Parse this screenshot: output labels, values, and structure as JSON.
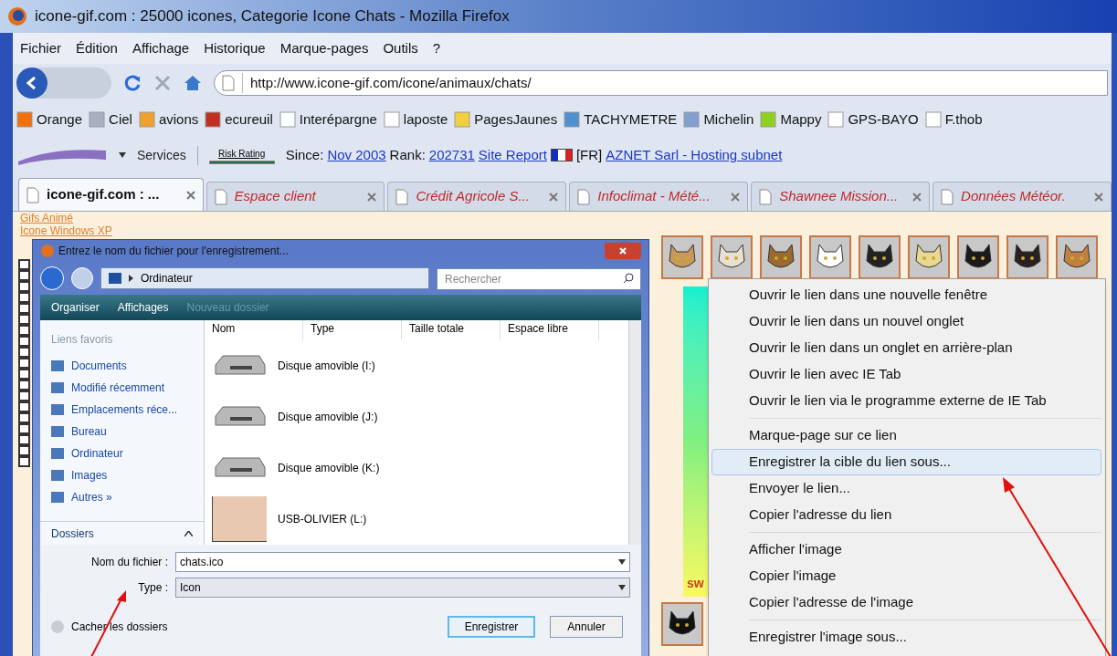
{
  "window": {
    "title": "icone-gif.com : 25000 icones, Categorie Icone Chats - Mozilla Firefox"
  },
  "menu_bar": [
    "Fichier",
    "Édition",
    "Affichage",
    "Historique",
    "Marque-pages",
    "Outils",
    "?"
  ],
  "address_bar": {
    "value": "http://www.icone-gif.com/icone/animaux/chats/"
  },
  "bookmarks": [
    "Orange",
    "Ciel",
    "avions",
    "ecureuil",
    "Interépargne",
    "laposte",
    "PagesJaunes",
    "TACHYMETRE",
    "Michelin",
    "Mappy",
    "GPS-BAYO",
    "F.thob"
  ],
  "netcraft_bar": {
    "services": "Services",
    "risk_label": "Risk Rating",
    "since_label": "Since:",
    "since": "Nov 2003",
    "rank_label": "Rank:",
    "rank": "202731",
    "report": "Site Report",
    "country": "[FR]",
    "host": "AZNET Sarl - Hosting subnet"
  },
  "tabs": [
    {
      "label": "icone-gif.com : ...",
      "selected": true
    },
    {
      "label": "Espace client",
      "selected": false
    },
    {
      "label": "Crédit Agricole S...",
      "selected": false
    },
    {
      "label": "Infoclimat - Mété...",
      "selected": false
    },
    {
      "label": "Shawnee Mission...",
      "selected": false
    },
    {
      "label": "Données Météor.",
      "selected": false
    }
  ],
  "page": {
    "links": [
      "Gifs Animé",
      "Icone Windows XP"
    ],
    "banner_text": "sw"
  },
  "save_dialog": {
    "title": "Entrez le nom du fichier pour l'enregistrement...",
    "path": "Ordinateur",
    "search_placeholder": "Rechercher",
    "toolbar": [
      {
        "label": "Organiser",
        "disabled": false
      },
      {
        "label": "Affichages",
        "disabled": false
      },
      {
        "label": "Nouveau dossier",
        "disabled": true
      }
    ],
    "favorites_title": "Liens favoris",
    "favorites": [
      "Documents",
      "Modifié récemment",
      "Emplacements réce...",
      "Bureau",
      "Ordinateur",
      "Images",
      "Autres »"
    ],
    "folders_label": "Dossiers",
    "columns": [
      "Nom",
      "Type",
      "Taille totale",
      "Espace libre"
    ],
    "items": [
      {
        "name": "Disque amovible (I:)",
        "kind": "drive"
      },
      {
        "name": "Disque amovible (J:)",
        "kind": "drive"
      },
      {
        "name": "Disque amovible (K:)",
        "kind": "drive"
      },
      {
        "name": "USB-OLIVIER (L:)",
        "kind": "picture"
      }
    ],
    "filename_label": "Nom du fichier :",
    "filename": "chats.ico",
    "type_label": "Type :",
    "type": "Icon",
    "hide_folders": "Cacher les dossiers",
    "buttons": [
      {
        "label": "Enregistrer",
        "default": true
      },
      {
        "label": "Annuler",
        "default": false
      }
    ]
  },
  "context_menu": [
    [
      {
        "label": "Ouvrir le lien dans une nouvelle fenêtre",
        "selected": false
      },
      {
        "label": "Ouvrir le lien dans un nouvel onglet",
        "selected": false
      },
      {
        "label": "Ouvrir le lien dans un onglet en arrière-plan",
        "selected": false
      },
      {
        "label": "Ouvrir le lien avec IE Tab",
        "selected": false
      },
      {
        "label": "Ouvrir le lien via le programme externe de IE Tab",
        "selected": false
      }
    ],
    [
      {
        "label": "Marque-page sur ce lien",
        "selected": false
      },
      {
        "label": "Enregistrer la cible du lien sous...",
        "selected": true
      },
      {
        "label": "Envoyer le lien...",
        "selected": false
      },
      {
        "label": "Copier l'adresse du lien",
        "selected": false
      }
    ],
    [
      {
        "label": "Afficher l'image",
        "selected": false
      },
      {
        "label": "Copier l'image",
        "selected": false
      },
      {
        "label": "Copier l'adresse de l'image",
        "selected": false
      }
    ],
    [
      {
        "label": "Enregistrer l'image sous...",
        "selected": false
      }
    ]
  ]
}
